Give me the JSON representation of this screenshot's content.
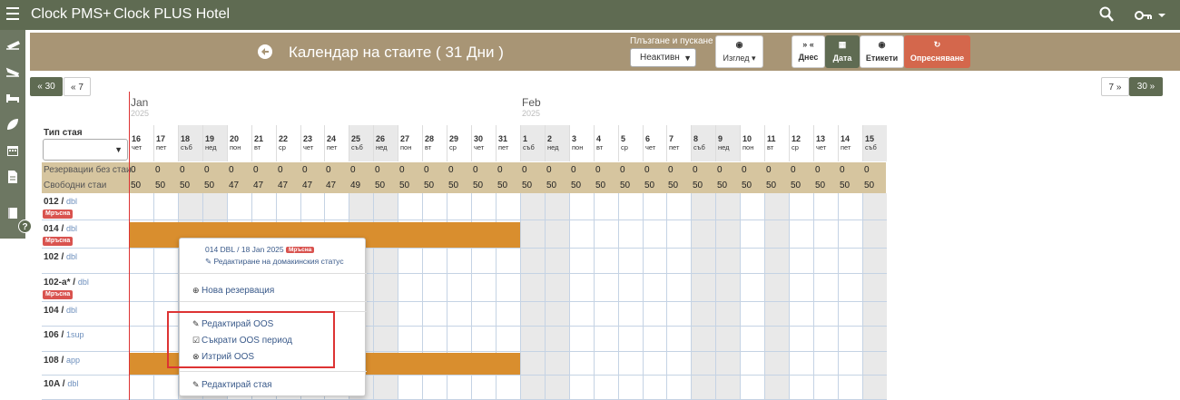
{
  "app": {
    "brand": "Clock PMS+",
    "hotel": "Clock PLUS Hotel"
  },
  "header": {
    "title": "Календар на стаите ( 31 Дни )",
    "drag_label": "Плъзгане и пускане",
    "drag_value": "Неактивн",
    "view_btn": "Изглед",
    "today_btn": "Днес",
    "date_btn": "Дата",
    "labels_btn": "Етикети",
    "refresh_btn": "Опресняване"
  },
  "nav": {
    "back30": "« 30",
    "back7": "« 7",
    "fwd7": "7 »",
    "fwd30": "30 »"
  },
  "months": [
    {
      "name": "Jan",
      "year": "2025"
    },
    {
      "name": "Feb",
      "year": "2025"
    }
  ],
  "room_type_label": "Тип стая",
  "days": [
    {
      "d": "16",
      "w": "чет"
    },
    {
      "d": "17",
      "w": "пет"
    },
    {
      "d": "18",
      "w": "съб"
    },
    {
      "d": "19",
      "w": "нед"
    },
    {
      "d": "20",
      "w": "пон"
    },
    {
      "d": "21",
      "w": "вт"
    },
    {
      "d": "22",
      "w": "ср"
    },
    {
      "d": "23",
      "w": "чет"
    },
    {
      "d": "24",
      "w": "пет"
    },
    {
      "d": "25",
      "w": "съб"
    },
    {
      "d": "26",
      "w": "нед"
    },
    {
      "d": "27",
      "w": "пон"
    },
    {
      "d": "28",
      "w": "вт"
    },
    {
      "d": "29",
      "w": "ср"
    },
    {
      "d": "30",
      "w": "чет"
    },
    {
      "d": "31",
      "w": "пет"
    },
    {
      "d": "1",
      "w": "съб"
    },
    {
      "d": "2",
      "w": "нед"
    },
    {
      "d": "3",
      "w": "пон"
    },
    {
      "d": "4",
      "w": "вт"
    },
    {
      "d": "5",
      "w": "ср"
    },
    {
      "d": "6",
      "w": "чет"
    },
    {
      "d": "7",
      "w": "пет"
    },
    {
      "d": "8",
      "w": "съб"
    },
    {
      "d": "9",
      "w": "нед"
    },
    {
      "d": "10",
      "w": "пон"
    },
    {
      "d": "11",
      "w": "вт"
    },
    {
      "d": "12",
      "w": "ср"
    },
    {
      "d": "13",
      "w": "чет"
    },
    {
      "d": "14",
      "w": "пет"
    },
    {
      "d": "15",
      "w": "съб"
    }
  ],
  "summary": [
    {
      "label": "Резервации без стаи",
      "values": [
        "0",
        "0",
        "0",
        "0",
        "0",
        "0",
        "0",
        "0",
        "0",
        "0",
        "0",
        "0",
        "0",
        "0",
        "0",
        "0",
        "0",
        "0",
        "0",
        "0",
        "0",
        "0",
        "0",
        "0",
        "0",
        "0",
        "0",
        "0",
        "0",
        "0",
        "0"
      ]
    },
    {
      "label": "Свободни стаи",
      "values": [
        "50",
        "50",
        "50",
        "50",
        "47",
        "47",
        "47",
        "47",
        "47",
        "49",
        "50",
        "50",
        "50",
        "50",
        "50",
        "50",
        "50",
        "50",
        "50",
        "50",
        "50",
        "50",
        "50",
        "50",
        "50",
        "50",
        "50",
        "50",
        "50",
        "50",
        "50"
      ]
    }
  ],
  "rooms": [
    {
      "num": "012 /",
      "type": "dbl",
      "badge": "Мръсна"
    },
    {
      "num": "014 /",
      "type": "dbl",
      "badge": "Мръсна"
    },
    {
      "num": "102 /",
      "type": "dbl",
      "badge": ""
    },
    {
      "num": "102-a* /",
      "type": "dbl",
      "badge": "Мръсна"
    },
    {
      "num": "104 /",
      "type": "dbl",
      "badge": ""
    },
    {
      "num": "106 /",
      "type": "1sup",
      "badge": ""
    },
    {
      "num": "108 /",
      "type": "app",
      "badge": ""
    },
    {
      "num": "10A /",
      "type": "dbl",
      "badge": ""
    }
  ],
  "context_menu": {
    "room_line": "014 DBL / 18 Jan 2025",
    "room_badge": "Мръсна",
    "edit_housekeeping": "Редактиране на домакинския статус",
    "new_reservation": "Нова резервация",
    "edit_oos": "Редактирай OOS",
    "shorten_oos": "Съкрати OOS период",
    "delete_oos": "Изтрий OOS",
    "edit_room": "Редактирай стая"
  },
  "colors": {
    "topbar": "#5f6b52",
    "header": "#a89575",
    "oos_bar": "#d98e2e",
    "dirty_badge": "#d9534f",
    "summary": "#d6c59f"
  }
}
